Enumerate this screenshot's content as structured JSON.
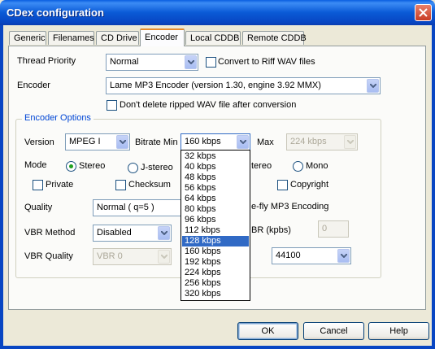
{
  "window": {
    "title": "CDex configuration"
  },
  "tabs": [
    {
      "label": "Generic",
      "active": false
    },
    {
      "label": "Filenames",
      "active": false
    },
    {
      "label": "CD Drive",
      "active": false
    },
    {
      "label": "Encoder",
      "active": true
    },
    {
      "label": "Local CDDB",
      "active": false
    },
    {
      "label": "Remote CDDB",
      "active": false
    }
  ],
  "general": {
    "thread_priority_label": "Thread Priority",
    "thread_priority_value": "Normal",
    "convert_riff_label": "Convert to Riff WAV files",
    "convert_riff_checked": false,
    "encoder_label": "Encoder",
    "encoder_value": "Lame MP3 Encoder (version 1.30, engine 3.92 MMX)",
    "dont_delete_label": "Don't delete ripped WAV file after conversion",
    "dont_delete_checked": false
  },
  "encoder_options": {
    "group_label": "Encoder Options",
    "version_label": "Version",
    "version_value": "MPEG I",
    "bitrate_min_label": "Bitrate Min",
    "bitrate_min_value": "160 kbps",
    "max_label": "Max",
    "max_value": "224 kbps",
    "mode_label": "Mode",
    "mode_stereo": "Stereo",
    "mode_jstereo": "J-stereo",
    "mode_dual_partial": "tereo",
    "mode_mono": "Mono",
    "mode_selected": "Stereo",
    "private_label": "Private",
    "checksum_label": "Checksum",
    "copyright_label": "Copyright",
    "quality_label": "Quality",
    "quality_value": "Normal ( q=5 )",
    "onthefly_partial": "e-fly MP3 Encoding",
    "vbr_method_label": "VBR Method",
    "vbr_method_value": "Disabled",
    "abr_partial": "BR (kpbs)",
    "abr_value": "0",
    "vbr_quality_label": "VBR Quality",
    "vbr_quality_value": "VBR 0",
    "samplerate_value": "44100"
  },
  "bitrate_dropdown": {
    "options": [
      "32 kbps",
      "40 kbps",
      "48 kbps",
      "56 kbps",
      "64 kbps",
      "80 kbps",
      "96 kbps",
      "112 kbps",
      "128 kbps",
      "160 kbps",
      "192 kbps",
      "224 kbps",
      "256 kbps",
      "320 kbps"
    ],
    "highlighted": "128 kbps"
  },
  "buttons": {
    "ok": "OK",
    "cancel": "Cancel",
    "help": "Help"
  },
  "colors": {
    "titlebar": "#0a5ad6",
    "selection": "#316ac5",
    "group_label": "#0046d5",
    "active_tab_accent": "#e68b2c"
  }
}
